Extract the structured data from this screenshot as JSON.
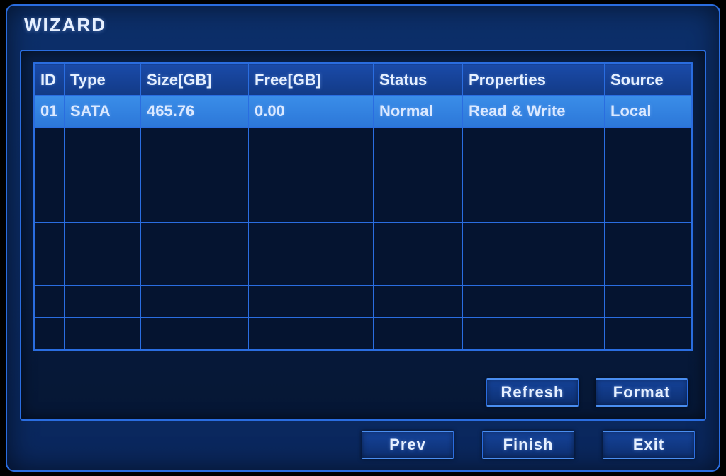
{
  "title": "WIZARD",
  "table": {
    "headers": {
      "id": "ID",
      "type": "Type",
      "size": "Size[GB]",
      "free": "Free[GB]",
      "status": "Status",
      "properties": "Properties",
      "source": "Source"
    },
    "rows": [
      {
        "id": "01",
        "type": "SATA",
        "size": "465.76",
        "free": "0.00",
        "status": "Normal",
        "properties": "Read & Write",
        "source": "Local",
        "selected": true
      }
    ],
    "total_visible_rows": 8
  },
  "inner_buttons": {
    "refresh": "Refresh",
    "format": "Format"
  },
  "footer_buttons": {
    "prev": "Prev",
    "finish": "Finish",
    "exit": "Exit"
  }
}
